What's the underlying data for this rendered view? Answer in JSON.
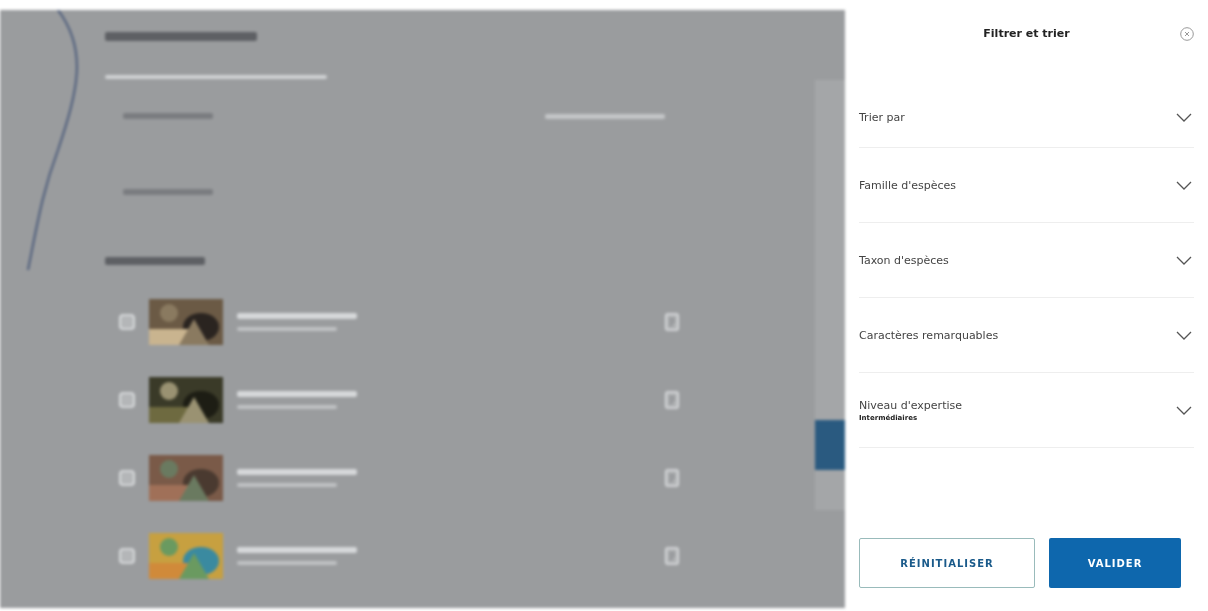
{
  "background": {
    "kind": "blurred"
  },
  "panel": {
    "title": "Filtrer et trier",
    "filters": [
      {
        "label": "Trier par",
        "expanded": false
      },
      {
        "label": "Famille d'espèces",
        "expanded": false
      },
      {
        "label": "Taxon d'espèces",
        "expanded": false
      },
      {
        "label": "Caractères remarquables",
        "expanded": false
      },
      {
        "label": "Niveau d'expertise",
        "value": "Intermédiaires",
        "expanded": false
      }
    ],
    "buttons": [
      {
        "label": "RÉINITIALISER",
        "kind": "secondary"
      },
      {
        "label": "VALIDER",
        "kind": "primary"
      }
    ]
  }
}
